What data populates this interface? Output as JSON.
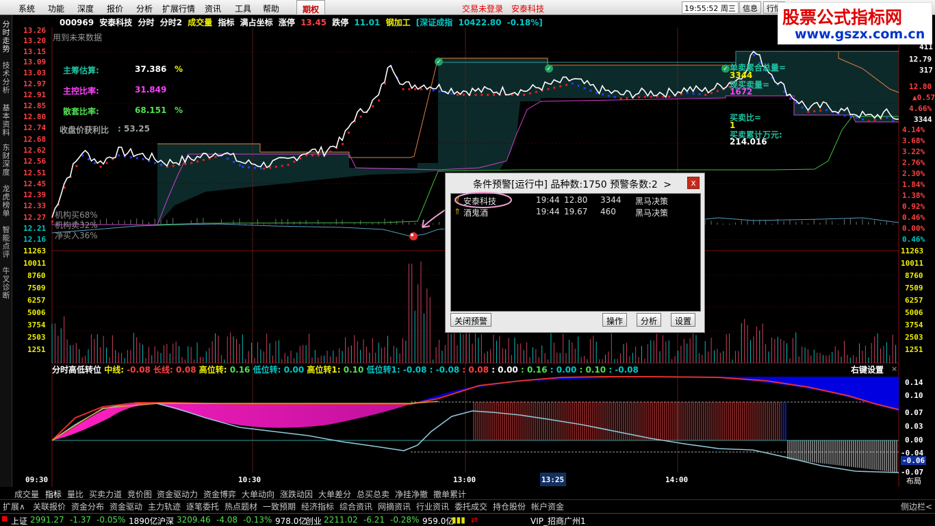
{
  "menu": {
    "items": [
      "系统",
      "功能",
      "深度",
      "报价",
      "分析",
      "扩展行情",
      "资讯",
      "工具",
      "帮助"
    ],
    "period": "期权",
    "login": "交易未登录",
    "stock_link": "安泰科技",
    "time": "19:55:52",
    "weekday": "周三",
    "buttons": [
      "信息",
      "行情"
    ]
  },
  "watermark": {
    "line1": "股票公式指标网",
    "line2": "www.gszx.com.cn"
  },
  "sidebar": {
    "tabs": [
      "分时走势",
      "技术分析",
      "基本资料",
      "东财深度",
      "龙虎榜单",
      "智能点评",
      "牛叉诊断"
    ]
  },
  "title": {
    "code": "000969",
    "name": "安泰科技",
    "tabs": [
      "分时",
      "分时2"
    ],
    "ind1": "成交量",
    "items": [
      "指标",
      "满占坐标",
      "涨停"
    ],
    "price": "13.45",
    "fall_label": "跌停",
    "fall": "11.01",
    "sector": "钢加工",
    "index_name": "[深证成指",
    "index_value": "10422.80",
    "index_change": "-0.18%]"
  },
  "note": "用到未来数据",
  "overlay": {
    "main_est_label": "主筹估算:",
    "main_est": "37.386",
    "pct": "%",
    "main_ctrl_label": "主控比率:",
    "main_ctrl": "31.849",
    "loose_label": "散套比率:",
    "loose": "68.151",
    "close_profit_label": "收盘价获利比",
    "close_profit": ": 53.25",
    "inst_buy": "机构买68%",
    "inst_sell": "机构卖32%",
    "net_buy": "净买入36%",
    "total_sell_label": "单卖累合总量=",
    "total_sell": "3344",
    "cur_sell_label": "现买卖量=",
    "cur_sell": "1672",
    "ratio_label": "买卖比=",
    "ratio": "1",
    "cum_label": "买卖累计万元:",
    "cum": "214.016"
  },
  "price_axis": {
    "left": [
      "13.26",
      "13.20",
      "13.15",
      "13.09",
      "13.03",
      "12.97",
      "12.91",
      "12.85",
      "12.80",
      "12.74",
      "12.68",
      "12.62",
      "12.56",
      "12.51",
      "12.45",
      "12.39",
      "12.33",
      "12.27",
      "12.21",
      "12.16"
    ],
    "right": [
      "4.14%",
      "3.68%",
      "3.22%",
      "2.76%",
      "2.30%",
      "1.84%",
      "1.38%",
      "0.92%",
      "0.46%",
      "0.00%",
      "0.46%"
    ],
    "right_top": [
      "411",
      "12.79",
      "317",
      "12.80",
      "0.57",
      "4.66%",
      "3344"
    ]
  },
  "volume_axis": [
    "11263",
    "10011",
    "8760",
    "7509",
    "6257",
    "5006",
    "3754",
    "2503",
    "1251"
  ],
  "indicator": {
    "name": "分时高低转位",
    "mid_label": "中线:",
    "mid": "-0.08",
    "long_label": "长线:",
    "long": "0.08",
    "high_label": "高位转:",
    "high": "0.16",
    "low_label": "低位转:",
    "low": "0.00",
    "high1_label": "高位转1:",
    "high1": "0.10",
    "low1_label": "低位转1:",
    "low1": "-0.08",
    "tail": [
      ": -0.08",
      ": 0.08",
      ": 0.00",
      ": 0.16",
      ": 0.00",
      ": 0.10",
      ": -0.08"
    ],
    "settings": "右键设置",
    "axis": [
      "0.14",
      "0.10",
      "0.07",
      "0.03",
      "0.00",
      "-0.04",
      "-0.06",
      "-0.07"
    ]
  },
  "time_axis": {
    "labels": [
      "09:30",
      "10:30",
      "13:00",
      "14:00"
    ],
    "cursor": "13:25",
    "layout": "布局"
  },
  "dialog": {
    "title": "条件预警[运行中] 品种数:1750 预警条数:2",
    "more": ">",
    "close": "x",
    "rows": [
      {
        "name": "安泰科技",
        "time": "19:44",
        "price": "12.80",
        "vol": "3344",
        "strategy": "黑马决策"
      },
      {
        "name": "酒鬼酒",
        "time": "19:44",
        "price": "19.67",
        "vol": "460",
        "strategy": "黑马决策"
      }
    ],
    "btn_close": "关闭预警",
    "btn_op": "操作",
    "btn_analyze": "分析",
    "btn_settings": "设置"
  },
  "tabs1": [
    "成交量",
    "指标",
    "量比",
    "买卖力道",
    "竞价图",
    "资金驱动力",
    "资金博弈",
    "大单动向",
    "涨跌动因",
    "大单差分",
    "总买总卖",
    "净挂净撤",
    "撤单累计"
  ],
  "tabs2": [
    "扩展∧",
    "关联报价",
    "资金分布",
    "资金驱动",
    "主力轨迹",
    "逐笔委托",
    "热点题材",
    "一致预期",
    "经济指标",
    "综合资讯",
    "网摘资讯",
    "行业资讯",
    "委托成交",
    "持仓股份",
    "帐户资金"
  ],
  "side_toggle": "侧边栏<",
  "status": {
    "sh_label": "上证",
    "sh": "2991.27",
    "sh_chg": "-1.37",
    "sh_pct": "-0.05%",
    "sh_amt": "1890亿",
    "sz_label": "沪深",
    "sz": "3209.46",
    "sz_chg": "-4.08",
    "sz_pct": "-0.13%",
    "sz_amt": "978.0亿",
    "cy_label": "创业",
    "cy": "2211.02",
    "cy_chg": "-6.21",
    "cy_pct": "-0.28%",
    "cy_amt": "959.0亿",
    "broker": "VIP_招商广州1"
  },
  "chart_data": {
    "type": "line",
    "x_labels": [
      "09:30",
      "10:30",
      "13:00",
      "14:00"
    ],
    "price_range": [
      12.16,
      13.26
    ],
    "prev_close": 12.27,
    "price_path": [
      [
        0,
        12.27
      ],
      [
        4,
        12.45
      ],
      [
        10,
        12.62
      ],
      [
        16,
        12.56
      ],
      [
        22,
        12.62
      ],
      [
        30,
        12.6
      ],
      [
        38,
        12.56
      ],
      [
        46,
        12.58
      ],
      [
        56,
        12.62
      ],
      [
        63,
        12.56
      ],
      [
        70,
        12.55
      ],
      [
        78,
        12.57
      ],
      [
        84,
        12.62
      ],
      [
        90,
        12.62
      ],
      [
        96,
        12.68
      ],
      [
        100,
        12.8
      ],
      [
        104,
        12.85
      ],
      [
        108,
        12.91
      ],
      [
        112,
        13.09
      ],
      [
        116,
        12.97
      ],
      [
        124,
        12.97
      ],
      [
        134,
        12.94
      ],
      [
        144,
        12.94
      ],
      [
        156,
        12.94
      ],
      [
        164,
        12.97
      ],
      [
        172,
        13.0
      ],
      [
        180,
        12.95
      ],
      [
        188,
        12.92
      ],
      [
        196,
        12.93
      ],
      [
        204,
        12.93
      ],
      [
        210,
        12.95
      ],
      [
        216,
        12.94
      ],
      [
        222,
        12.97
      ],
      [
        228,
        13.01
      ],
      [
        232,
        13.15
      ],
      [
        238,
        13.03
      ],
      [
        244,
        12.92
      ],
      [
        250,
        12.85
      ],
      [
        256,
        12.86
      ],
      [
        262,
        12.83
      ],
      [
        266,
        12.82
      ],
      [
        270,
        12.8
      ],
      [
        276,
        12.82
      ],
      [
        280,
        12.79
      ]
    ]
  }
}
